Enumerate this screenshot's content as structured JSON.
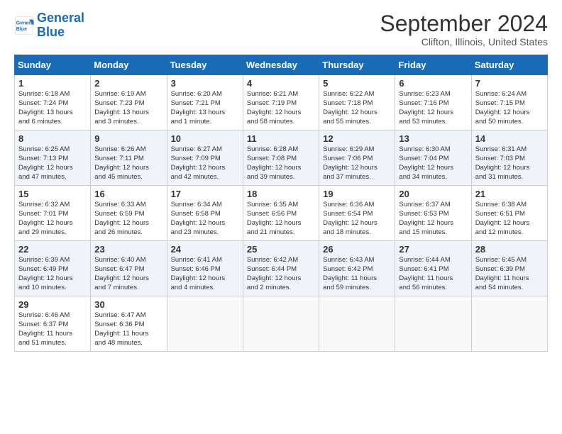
{
  "header": {
    "logo_line1": "General",
    "logo_line2": "Blue",
    "month_year": "September 2024",
    "location": "Clifton, Illinois, United States"
  },
  "days_of_week": [
    "Sunday",
    "Monday",
    "Tuesday",
    "Wednesday",
    "Thursday",
    "Friday",
    "Saturday"
  ],
  "weeks": [
    [
      {
        "day": "1",
        "lines": [
          "Sunrise: 6:18 AM",
          "Sunset: 7:24 PM",
          "Daylight: 13 hours",
          "and 6 minutes."
        ]
      },
      {
        "day": "2",
        "lines": [
          "Sunrise: 6:19 AM",
          "Sunset: 7:23 PM",
          "Daylight: 13 hours",
          "and 3 minutes."
        ]
      },
      {
        "day": "3",
        "lines": [
          "Sunrise: 6:20 AM",
          "Sunset: 7:21 PM",
          "Daylight: 13 hours",
          "and 1 minute."
        ]
      },
      {
        "day": "4",
        "lines": [
          "Sunrise: 6:21 AM",
          "Sunset: 7:19 PM",
          "Daylight: 12 hours",
          "and 58 minutes."
        ]
      },
      {
        "day": "5",
        "lines": [
          "Sunrise: 6:22 AM",
          "Sunset: 7:18 PM",
          "Daylight: 12 hours",
          "and 55 minutes."
        ]
      },
      {
        "day": "6",
        "lines": [
          "Sunrise: 6:23 AM",
          "Sunset: 7:16 PM",
          "Daylight: 12 hours",
          "and 53 minutes."
        ]
      },
      {
        "day": "7",
        "lines": [
          "Sunrise: 6:24 AM",
          "Sunset: 7:15 PM",
          "Daylight: 12 hours",
          "and 50 minutes."
        ]
      }
    ],
    [
      {
        "day": "8",
        "lines": [
          "Sunrise: 6:25 AM",
          "Sunset: 7:13 PM",
          "Daylight: 12 hours",
          "and 47 minutes."
        ]
      },
      {
        "day": "9",
        "lines": [
          "Sunrise: 6:26 AM",
          "Sunset: 7:11 PM",
          "Daylight: 12 hours",
          "and 45 minutes."
        ]
      },
      {
        "day": "10",
        "lines": [
          "Sunrise: 6:27 AM",
          "Sunset: 7:09 PM",
          "Daylight: 12 hours",
          "and 42 minutes."
        ]
      },
      {
        "day": "11",
        "lines": [
          "Sunrise: 6:28 AM",
          "Sunset: 7:08 PM",
          "Daylight: 12 hours",
          "and 39 minutes."
        ]
      },
      {
        "day": "12",
        "lines": [
          "Sunrise: 6:29 AM",
          "Sunset: 7:06 PM",
          "Daylight: 12 hours",
          "and 37 minutes."
        ]
      },
      {
        "day": "13",
        "lines": [
          "Sunrise: 6:30 AM",
          "Sunset: 7:04 PM",
          "Daylight: 12 hours",
          "and 34 minutes."
        ]
      },
      {
        "day": "14",
        "lines": [
          "Sunrise: 6:31 AM",
          "Sunset: 7:03 PM",
          "Daylight: 12 hours",
          "and 31 minutes."
        ]
      }
    ],
    [
      {
        "day": "15",
        "lines": [
          "Sunrise: 6:32 AM",
          "Sunset: 7:01 PM",
          "Daylight: 12 hours",
          "and 29 minutes."
        ]
      },
      {
        "day": "16",
        "lines": [
          "Sunrise: 6:33 AM",
          "Sunset: 6:59 PM",
          "Daylight: 12 hours",
          "and 26 minutes."
        ]
      },
      {
        "day": "17",
        "lines": [
          "Sunrise: 6:34 AM",
          "Sunset: 6:58 PM",
          "Daylight: 12 hours",
          "and 23 minutes."
        ]
      },
      {
        "day": "18",
        "lines": [
          "Sunrise: 6:35 AM",
          "Sunset: 6:56 PM",
          "Daylight: 12 hours",
          "and 21 minutes."
        ]
      },
      {
        "day": "19",
        "lines": [
          "Sunrise: 6:36 AM",
          "Sunset: 6:54 PM",
          "Daylight: 12 hours",
          "and 18 minutes."
        ]
      },
      {
        "day": "20",
        "lines": [
          "Sunrise: 6:37 AM",
          "Sunset: 6:53 PM",
          "Daylight: 12 hours",
          "and 15 minutes."
        ]
      },
      {
        "day": "21",
        "lines": [
          "Sunrise: 6:38 AM",
          "Sunset: 6:51 PM",
          "Daylight: 12 hours",
          "and 12 minutes."
        ]
      }
    ],
    [
      {
        "day": "22",
        "lines": [
          "Sunrise: 6:39 AM",
          "Sunset: 6:49 PM",
          "Daylight: 12 hours",
          "and 10 minutes."
        ]
      },
      {
        "day": "23",
        "lines": [
          "Sunrise: 6:40 AM",
          "Sunset: 6:47 PM",
          "Daylight: 12 hours",
          "and 7 minutes."
        ]
      },
      {
        "day": "24",
        "lines": [
          "Sunrise: 6:41 AM",
          "Sunset: 6:46 PM",
          "Daylight: 12 hours",
          "and 4 minutes."
        ]
      },
      {
        "day": "25",
        "lines": [
          "Sunrise: 6:42 AM",
          "Sunset: 6:44 PM",
          "Daylight: 12 hours",
          "and 2 minutes."
        ]
      },
      {
        "day": "26",
        "lines": [
          "Sunrise: 6:43 AM",
          "Sunset: 6:42 PM",
          "Daylight: 11 hours",
          "and 59 minutes."
        ]
      },
      {
        "day": "27",
        "lines": [
          "Sunrise: 6:44 AM",
          "Sunset: 6:41 PM",
          "Daylight: 11 hours",
          "and 56 minutes."
        ]
      },
      {
        "day": "28",
        "lines": [
          "Sunrise: 6:45 AM",
          "Sunset: 6:39 PM",
          "Daylight: 11 hours",
          "and 54 minutes."
        ]
      }
    ],
    [
      {
        "day": "29",
        "lines": [
          "Sunrise: 6:46 AM",
          "Sunset: 6:37 PM",
          "Daylight: 11 hours",
          "and 51 minutes."
        ]
      },
      {
        "day": "30",
        "lines": [
          "Sunrise: 6:47 AM",
          "Sunset: 6:36 PM",
          "Daylight: 11 hours",
          "and 48 minutes."
        ]
      },
      null,
      null,
      null,
      null,
      null
    ]
  ]
}
